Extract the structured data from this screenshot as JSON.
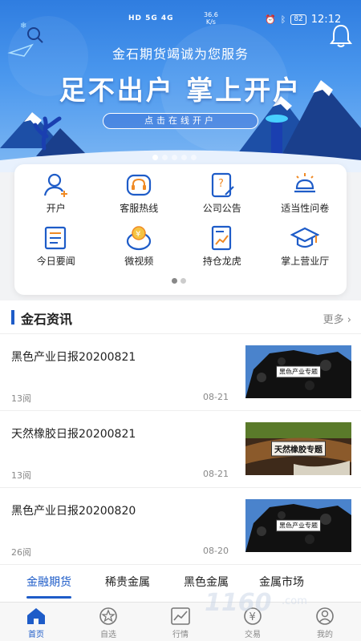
{
  "status_bar": {
    "network": "HD 5G 4G",
    "speed": "36.6",
    "speed_unit": "K/s",
    "battery": "82",
    "time": "12:12"
  },
  "banner": {
    "subtitle": "金石期货竭诚为您服务",
    "headline": "足不出户 掌上开户",
    "cta": "点击在线开户",
    "slide_count": 5,
    "active_slide": 0
  },
  "quick_menu": {
    "items": [
      {
        "label": "开户",
        "icon": "add-user-icon"
      },
      {
        "label": "客服热线",
        "icon": "headset-icon"
      },
      {
        "label": "公司公告",
        "icon": "announcement-icon"
      },
      {
        "label": "适当性问卷",
        "icon": "lightbulb-icon"
      },
      {
        "label": "今日要闻",
        "icon": "newspaper-icon"
      },
      {
        "label": "微视频",
        "icon": "yuan-video-icon"
      },
      {
        "label": "持仓龙虎",
        "icon": "chart-doc-icon"
      },
      {
        "label": "掌上营业厅",
        "icon": "graduation-cap-icon"
      }
    ],
    "page_count": 2,
    "active_page": 0
  },
  "news": {
    "title": "金石资讯",
    "more": "更多",
    "articles": [
      {
        "title": "黑色产业日报20200821",
        "reads": "13阅",
        "date": "08-21",
        "thumb_label": "黑色产业专题"
      },
      {
        "title": "天然橡胶日报20200821",
        "reads": "13阅",
        "date": "08-21",
        "thumb_label": "天然橡胶专题"
      },
      {
        "title": "黑色产业日报20200820",
        "reads": "26阅",
        "date": "08-20",
        "thumb_label": "黑色产业专题"
      }
    ]
  },
  "market_tabs": [
    "金融期货",
    "稀贵金属",
    "黑色金属",
    "金属市场"
  ],
  "bottom_nav": [
    {
      "label": "首页",
      "icon": "home-icon",
      "active": true
    },
    {
      "label": "自选",
      "icon": "star-icon",
      "active": false
    },
    {
      "label": "行情",
      "icon": "line-chart-icon",
      "active": false
    },
    {
      "label": "交易",
      "icon": "yuan-icon",
      "active": false
    },
    {
      "label": "我的",
      "icon": "user-icon",
      "active": false
    }
  ],
  "colors": {
    "primary": "#1e5cc8",
    "banner_top": "#2f7de0",
    "banner_bottom": "#7fb8f3"
  }
}
